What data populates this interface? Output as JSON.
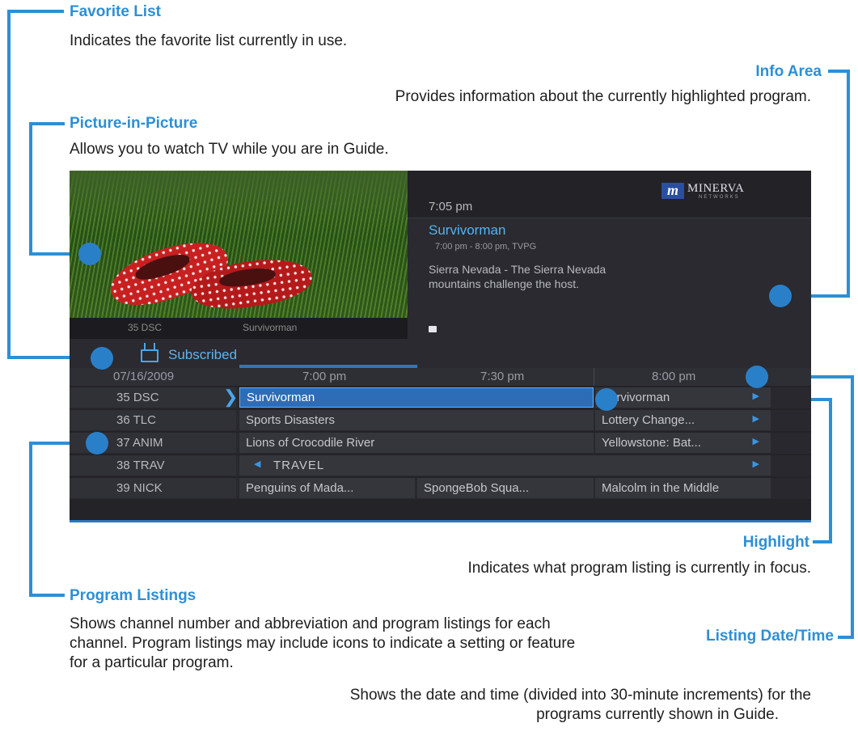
{
  "callouts": {
    "favorite_list": {
      "title": "Favorite List",
      "desc": "Indicates the favorite list currently in use."
    },
    "info_area": {
      "title": "Info Area",
      "desc": "Provides information about the currently highlighted program."
    },
    "pip": {
      "title": "Picture-in-Picture",
      "desc": "Allows you to watch TV while you are in Guide."
    },
    "highlight": {
      "title": "Highlight",
      "desc": "Indicates what program listing is currently in focus."
    },
    "program_listings": {
      "title": "Program Listings",
      "desc_lines": [
        "Shows channel number and abbreviation and program listings for each",
        "channel. Program listings may include icons to indicate a setting or feature",
        "for a particular program."
      ]
    },
    "listing_datetime": {
      "title": "Listing Date/Time",
      "desc_lines": [
        "Shows the date and time (divided into 30-minute increments) for the",
        "programs currently shown in Guide."
      ]
    }
  },
  "guide": {
    "logo_m": "m",
    "logo_name": "MINERVA",
    "logo_sub": "NETWORKS",
    "clock": "7:05 pm",
    "program_title": "Survivorman",
    "program_meta": "7:00 pm - 8:00 pm, TVPG",
    "program_desc_1": "Sierra Nevada - The Sierra Nevada",
    "program_desc_2": "mountains challenge the host.",
    "pip_channel": "35  DSC",
    "pip_program": "Survivorman",
    "favorite_list": "Subscribed",
    "date": "07/16/2009",
    "times": [
      "7:00 pm",
      "7:30 pm",
      "8:00 pm"
    ],
    "rows": [
      {
        "channel": "35 DSC",
        "cells": [
          "Survivorman",
          "Survivorman"
        ]
      },
      {
        "channel": "36 TLC",
        "cells": [
          "Sports Disasters",
          "Lottery Change..."
        ]
      },
      {
        "channel": "37 ANIM",
        "cells": [
          "Lions of Crocodile River",
          "Yellowstone: Bat..."
        ]
      },
      {
        "channel": "38 TRAV",
        "cells": [
          "TRAVEL"
        ]
      },
      {
        "channel": "39 NICK",
        "cells": [
          "Penguins of Mada...",
          "SpongeBob Squa...",
          "Malcolm in the Middle"
        ]
      }
    ]
  },
  "colors": {
    "accent": "#2d8fd5",
    "screen_bg": "#232328",
    "highlight": "#2a6fb8"
  }
}
